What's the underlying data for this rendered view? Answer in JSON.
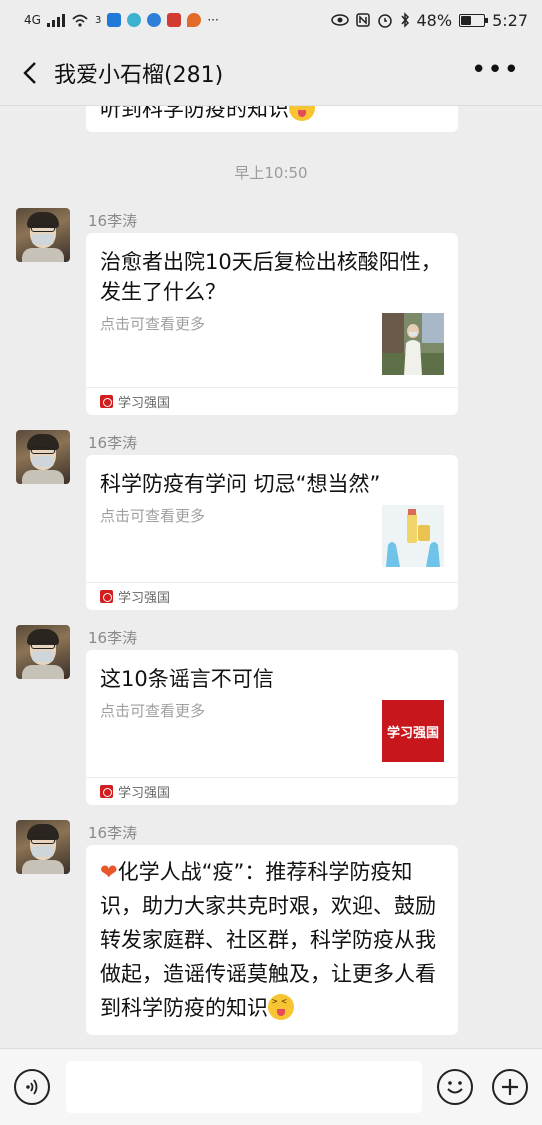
{
  "status_bar": {
    "network": "4G",
    "signal_extra": "3",
    "battery": "48%",
    "battery_level": 0.48,
    "time": "5:27"
  },
  "header": {
    "title": "我爱小石榴(281)"
  },
  "previous_message": {
    "text": "听到科学防疫的知识"
  },
  "timestamp": "早上10:50",
  "messages": [
    {
      "sender": "16李涛",
      "card_title": "治愈者出院10天后复检出核酸阳性，发生了什么？",
      "card_desc": "点击可查看更多",
      "source": "学习强国",
      "thumb": "person-photo"
    },
    {
      "sender": "16李涛",
      "card_title": "科学防疫有学问 切忌“想当然”",
      "card_desc": "点击可查看更多",
      "source": "学习强国",
      "thumb": "gloves-photo"
    },
    {
      "sender": "16李涛",
      "card_title": "这10条谣言不可信",
      "card_desc": "点击可查看更多",
      "source": "学习强国",
      "thumb": "xuexi-logo",
      "thumb_text": "学习强国"
    },
    {
      "sender": "16李涛",
      "text": "化学人战“疫”：推荐科学防疫知识，助力大家共克时艰，欢迎、鼓励转发家庭群、社区群，科学防疫从我做起，造谣传谣莫触及，让更多人看到科学防疫的知识"
    }
  ],
  "colors": {
    "background": "#ededed",
    "bubble": "#ffffff",
    "source_red": "#d21e1e",
    "heart": "#e8562a"
  }
}
